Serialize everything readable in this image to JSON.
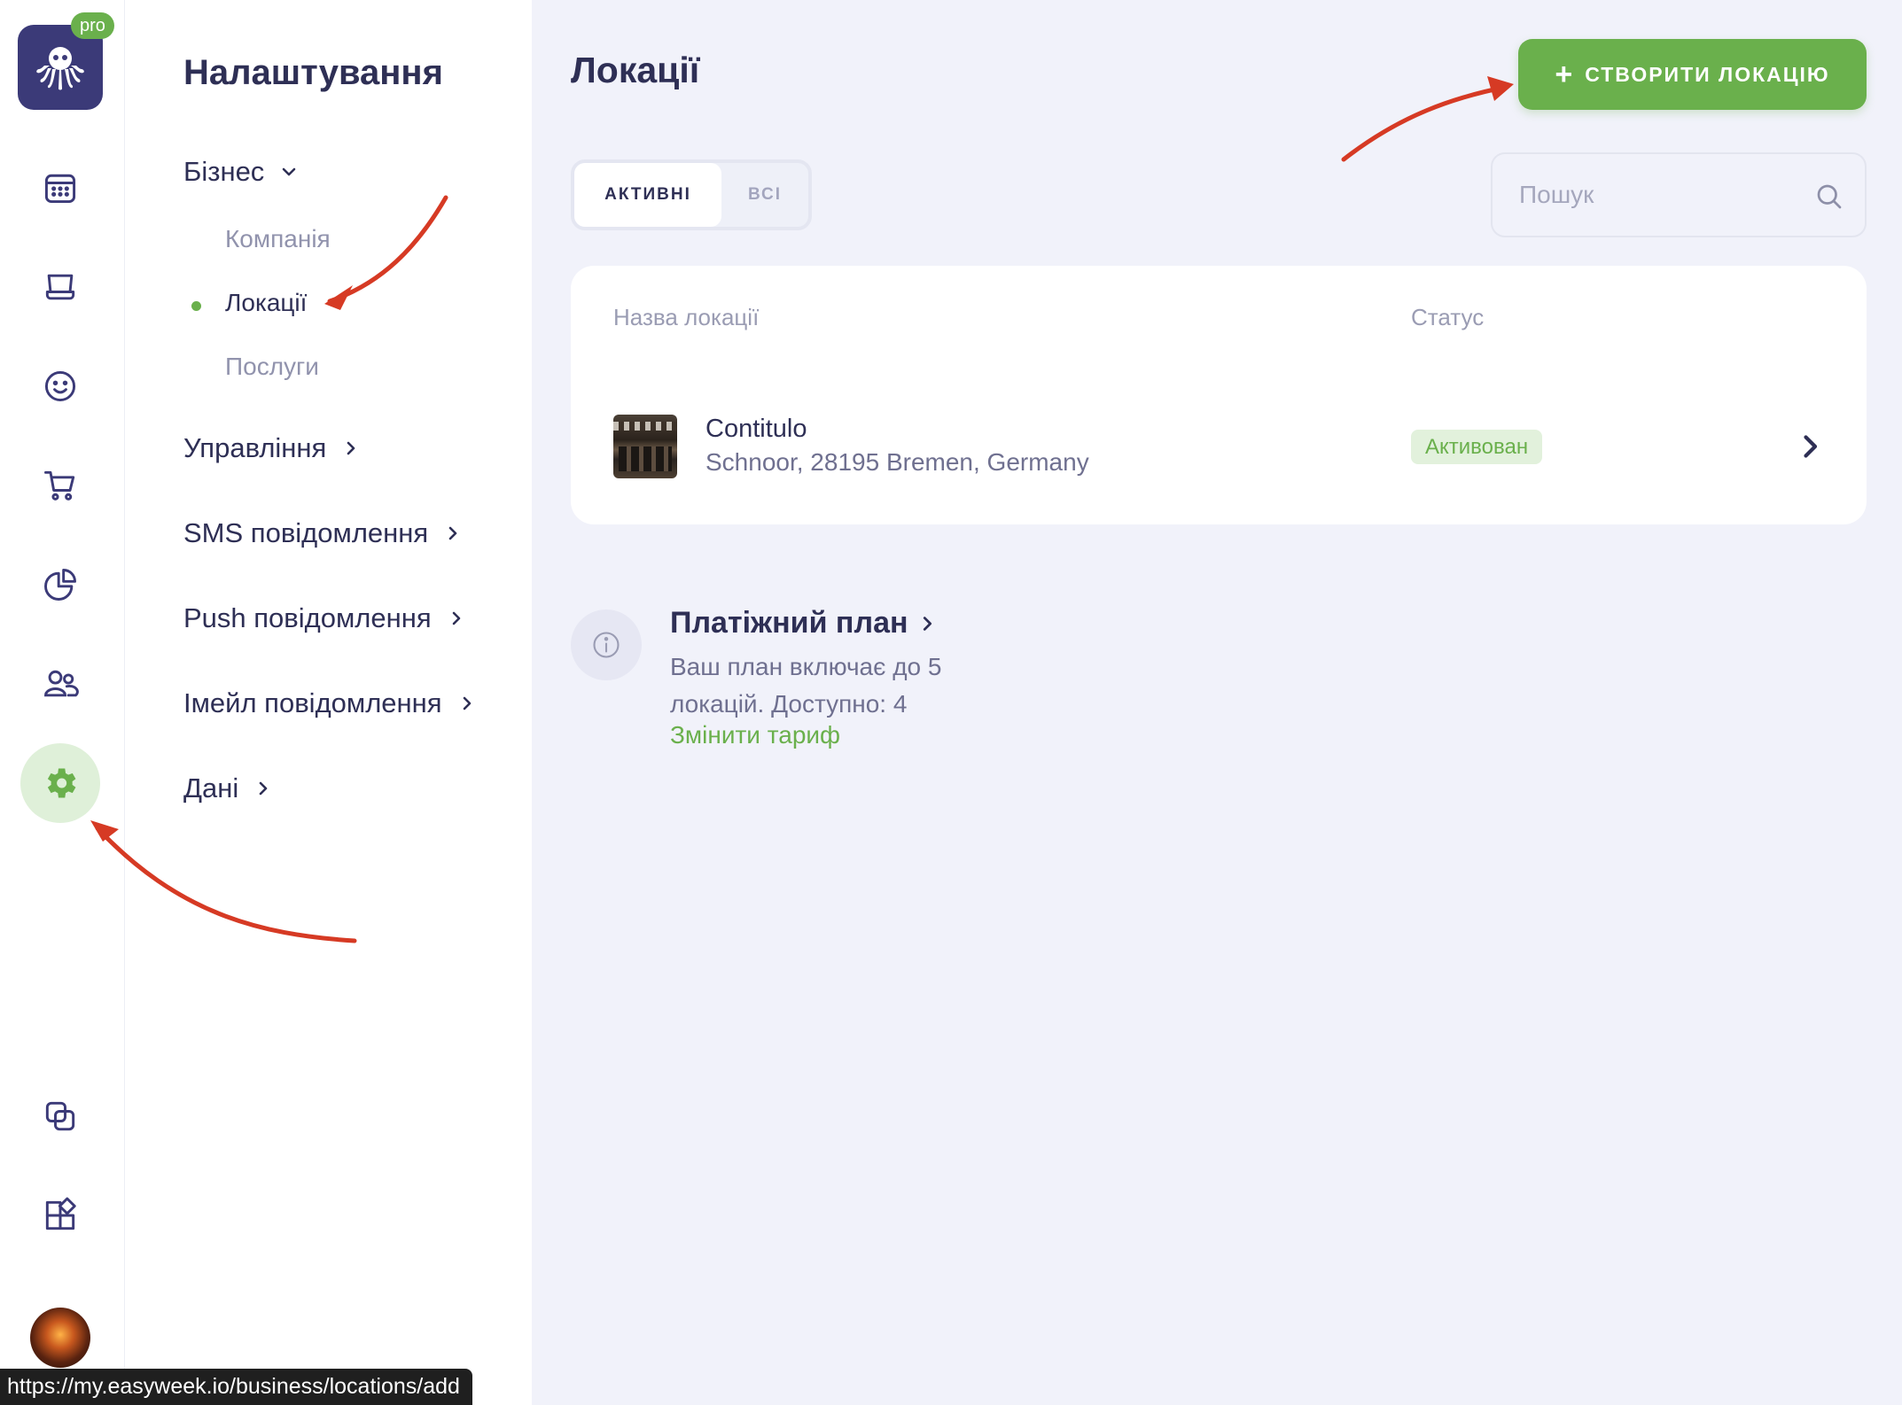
{
  "rail": {
    "logo_badge": "pro",
    "icons": [
      "octopus-logo",
      "calendar-icon",
      "monitor-icon",
      "smile-icon",
      "cart-icon",
      "pie-chart-icon",
      "users-icon",
      "gear-icon",
      "copy-icon",
      "apps-icon"
    ],
    "active_icon": "gear-icon"
  },
  "status_url": "https://my.easyweek.io/business/locations/add",
  "settings": {
    "title": "Налаштування",
    "groups": [
      {
        "label": "Бізнес",
        "expanded": true
      },
      {
        "label": "Управління",
        "expanded": false
      },
      {
        "label": "SMS повідомлення",
        "expanded": false
      },
      {
        "label": "Push повідомлення",
        "expanded": false
      },
      {
        "label": "Імейл повідомлення",
        "expanded": false
      },
      {
        "label": "Дані",
        "expanded": false
      }
    ],
    "business_items": [
      {
        "label": "Компанія",
        "active": false
      },
      {
        "label": "Локації",
        "active": true
      },
      {
        "label": "Послуги",
        "active": false
      }
    ]
  },
  "main": {
    "title": "Локації",
    "create_button": {
      "icon": "+",
      "label": "СТВОРИТИ ЛОКАЦІЮ"
    },
    "tabs": [
      {
        "label": "АКТИВНІ",
        "selected": true
      },
      {
        "label": "ВСІ",
        "selected": false
      }
    ],
    "search": {
      "placeholder": "Пошук",
      "value": ""
    },
    "table": {
      "columns": [
        "Назва локації",
        "Статус"
      ],
      "rows": [
        {
          "name": "Contitulo",
          "address": "Schnoor, 28195 Bremen, Germany",
          "status": "Активован"
        }
      ]
    },
    "plan": {
      "title": "Платіжний план",
      "line1": "Ваш план включає до 5",
      "line2": "локацій. Доступно: 4",
      "link": "Змінити тариф"
    }
  },
  "colors": {
    "accent": "#6ab04c",
    "dark_text": "#2e2f55",
    "muted_text": "#9a9cb3",
    "background": "#f1f2fa",
    "annotation_arrow": "#d63a24",
    "logo_bg": "#3b3a78"
  }
}
